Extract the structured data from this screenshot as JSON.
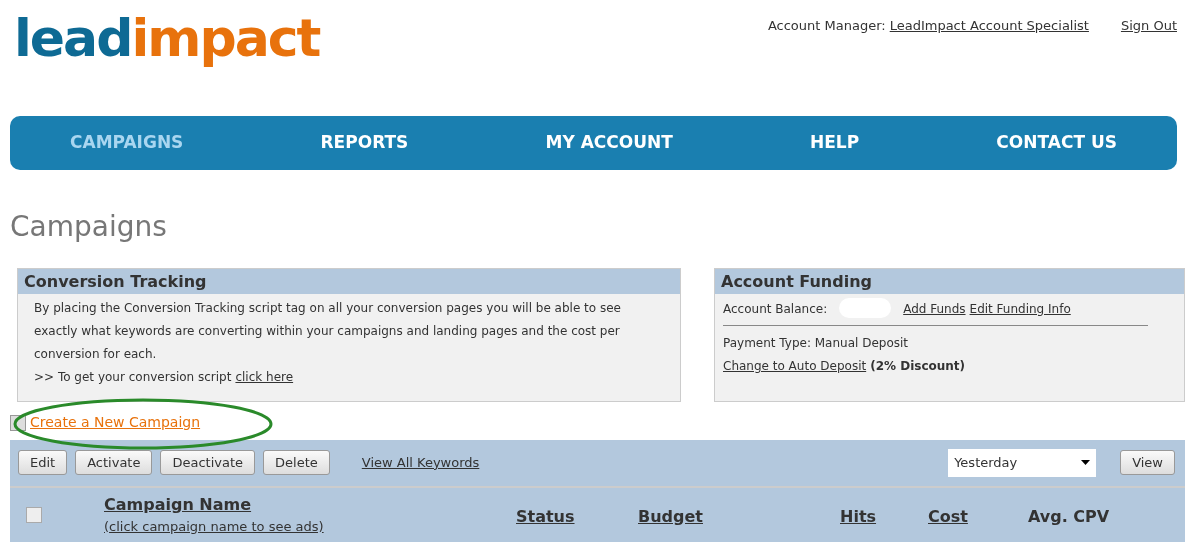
{
  "logo": {
    "parts": [
      {
        "text": "lead",
        "color": "#0e6a94"
      },
      {
        "text": "impact",
        "color": "#e8720c"
      }
    ]
  },
  "header": {
    "manager_label": "Account Manager:",
    "manager_link": "LeadImpact Account Specialist",
    "sign_out": "Sign Out"
  },
  "nav": [
    {
      "label": "CAMPAIGNS",
      "selected": true
    },
    {
      "label": "REPORTS",
      "selected": false
    },
    {
      "label": "MY ACCOUNT",
      "selected": false
    },
    {
      "label": "HELP",
      "selected": false
    },
    {
      "label": "CONTACT US",
      "selected": false
    }
  ],
  "page_title": "Campaigns",
  "conversion_tracking": {
    "title": "Conversion Tracking",
    "text": "By placing the Conversion Tracking script tag on all your conversion pages you will be able to see exactly what keywords are converting within your campaigns and landing pages and the cost per conversion for each.",
    "cta_text": ">> To get your conversion script",
    "cta_link": "click here"
  },
  "account_funding": {
    "title": "Account Funding",
    "balance_label": "Account Balance:",
    "links": [
      "Add Funds",
      "Edit Funding Info"
    ],
    "payment_type": "Payment Type: Manual Deposit",
    "change_link": "Change to Auto Deposit",
    "discount": "(2% Discount)"
  },
  "create_campaign": {
    "label": "Create a New Campaign",
    "highlighted": true
  },
  "toolbar": {
    "buttons": [
      "Edit",
      "Activate",
      "Deactivate",
      "Delete"
    ],
    "keywords_link": "View All Keywords",
    "period": "Yesterday",
    "view_button": "View"
  },
  "table": {
    "select_all_checked": false,
    "columns": [
      {
        "label": "Campaign Name",
        "sub": "(click campaign name to see ads)",
        "sortable": true
      },
      {
        "label": "Status",
        "sortable": true
      },
      {
        "label": "Budget",
        "sortable": true
      },
      {
        "label": "Hits",
        "sortable": true
      },
      {
        "label": "Cost",
        "sortable": true
      },
      {
        "label": "Avg. CPV",
        "sortable": false
      }
    ]
  }
}
